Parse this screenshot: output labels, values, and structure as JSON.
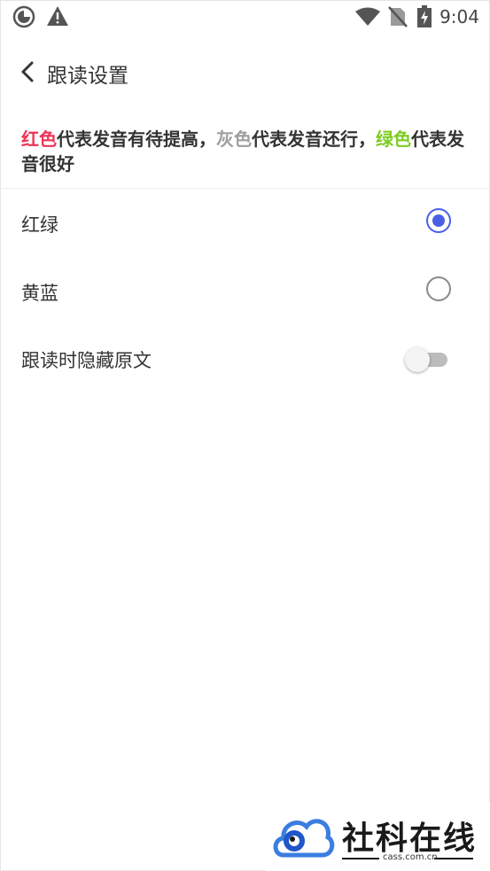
{
  "status_bar": {
    "time": "9:04",
    "icons": [
      "sync-circle-icon",
      "warning-icon",
      "wifi-icon",
      "no-sim-icon",
      "battery-charging-icon"
    ]
  },
  "app_bar": {
    "back_icon": "chevron-left-icon",
    "title": "跟读设置"
  },
  "legend": {
    "red_word": "红色",
    "part1": "代表发音有待提高，",
    "gray_word": "灰色",
    "part2": "代表发音还行，",
    "green_word": "绿色",
    "part3": "代表发音很好",
    "colors": {
      "red": "#ee3355",
      "gray": "#9e9e9e",
      "green": "#7ccc20"
    }
  },
  "options": [
    {
      "label": "红绿",
      "selected": true
    },
    {
      "label": "黄蓝",
      "selected": false
    }
  ],
  "hide_original": {
    "label": "跟读时隐藏原文",
    "enabled": false
  },
  "accent_color": "#4a5fe6",
  "watermark": {
    "text": "社科在线",
    "domain": "cass.com.cn"
  }
}
